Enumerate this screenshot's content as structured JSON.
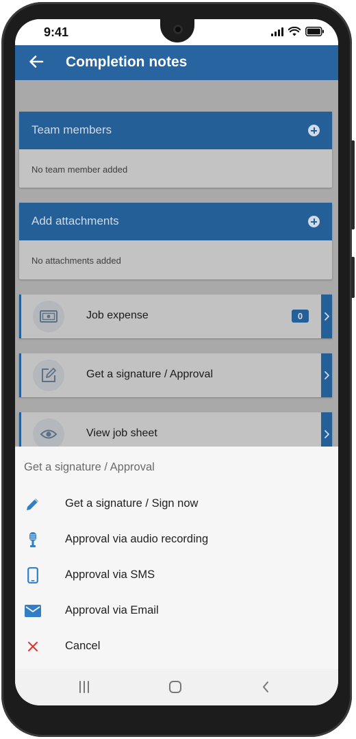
{
  "status_bar": {
    "time": "9:41"
  },
  "app_bar": {
    "title": "Completion notes"
  },
  "sections": [
    {
      "title": "Team members",
      "empty_text": "No team member added"
    },
    {
      "title": "Add attachments",
      "empty_text": "No attachments added"
    }
  ],
  "actions": [
    {
      "label": "Job expense",
      "icon": "money-icon",
      "badge": "0"
    },
    {
      "label": "Get a signature / Approval",
      "icon": "edit-icon"
    },
    {
      "label": "View job sheet",
      "icon": "eye-icon"
    }
  ],
  "sheet": {
    "title": "Get a signature / Approval",
    "items": [
      {
        "label": "Get a signature / Sign now",
        "icon": "pencil-icon"
      },
      {
        "label": "Approval via audio recording",
        "icon": "microphone-icon"
      },
      {
        "label": "Approval via SMS",
        "icon": "smartphone-icon"
      },
      {
        "label": "Approval via Email",
        "icon": "email-icon"
      },
      {
        "label": "Cancel",
        "icon": "close-icon"
      }
    ]
  },
  "colors": {
    "primary": "#2764a0",
    "icon_blue": "#2f7ec6",
    "cancel_red": "#e0312f",
    "scrim_gray": "#a9a9a9"
  }
}
